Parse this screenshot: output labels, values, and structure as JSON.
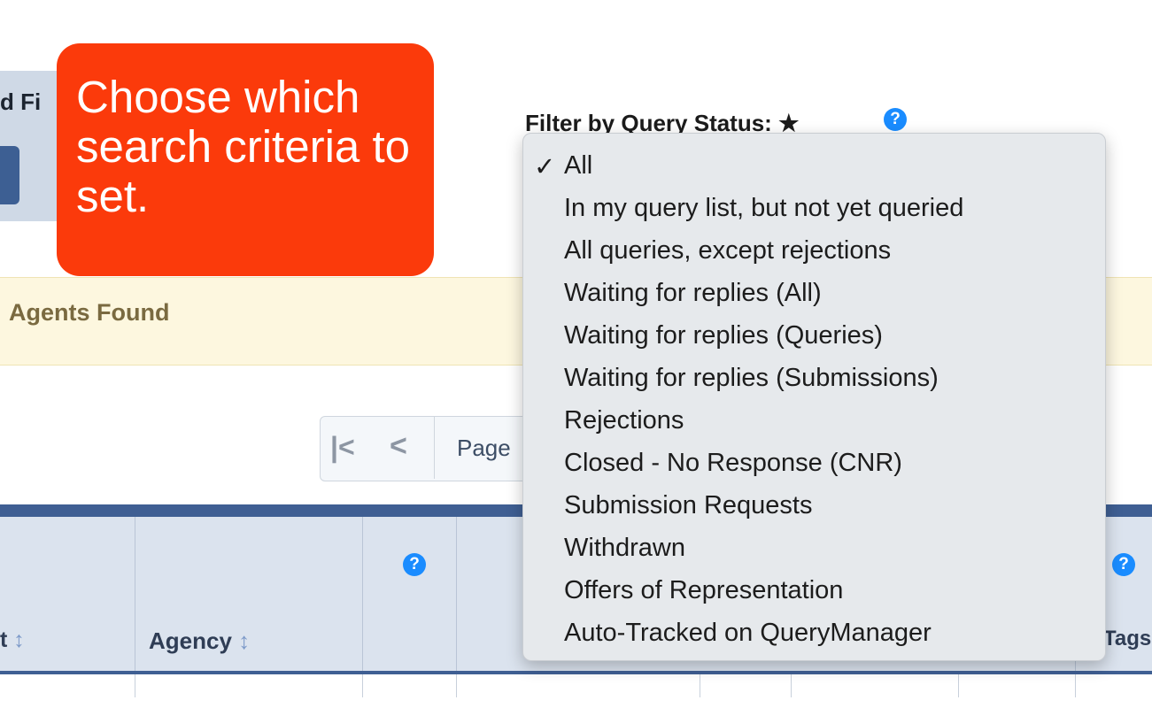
{
  "left_tab": {
    "label": "d Fi"
  },
  "banner": {
    "found_text": "Agents Found"
  },
  "pager": {
    "first_glyph": "K",
    "prev_glyph": "<",
    "page_label": "Page"
  },
  "table": {
    "columns": {
      "col1_label": "t",
      "col1_sort": "↕",
      "agency_label": "Agency",
      "agency_sort": "↕",
      "tags_label": "Tags"
    }
  },
  "filter": {
    "label": "Filter by Query Status: ★",
    "help": "?",
    "options": [
      "All",
      "In my query list, but not yet queried",
      "All queries, except rejections",
      "Waiting for replies (All)",
      "Waiting for replies (Queries)",
      "Waiting for replies (Submissions)",
      "Rejections",
      "Closed - No Response (CNR)",
      "Submission Requests",
      "Withdrawn",
      "Offers of Representation",
      "Auto-Tracked on QueryManager"
    ],
    "selected": "All",
    "check_mark": "✓"
  },
  "callout": {
    "text": "Choose which search criteria to set."
  },
  "help_icon_glyph": "?",
  "colors": {
    "accent": "#3f5f93",
    "callout": "#fb3a0b",
    "help": "#1a8cff"
  }
}
